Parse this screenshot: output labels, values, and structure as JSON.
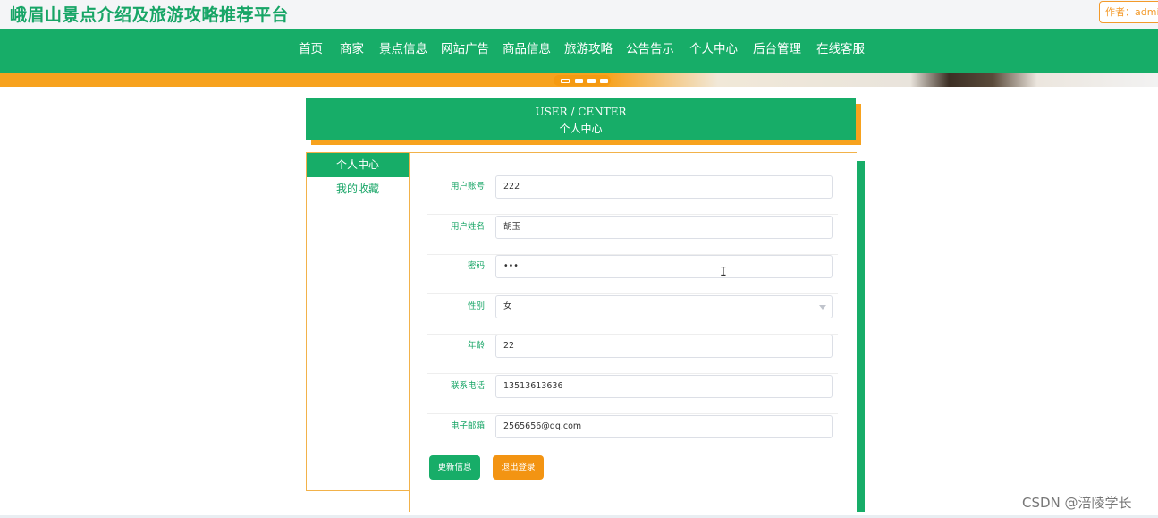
{
  "header": {
    "site_title": "峨眉山景点介绍及旅游攻略推荐平台",
    "author": "作者：admin"
  },
  "nav": {
    "items": [
      "首页",
      "商家",
      "景点信息",
      "网站广告",
      "商品信息",
      "旅游攻略",
      "公告告示",
      "个人中心",
      "后台管理",
      "在线客服"
    ]
  },
  "user_center": {
    "title_en": "USER / CENTER",
    "title_cn": "个人中心"
  },
  "sidebar": {
    "items": [
      {
        "label": "个人中心",
        "active": true
      },
      {
        "label": "我的收藏",
        "active": false
      }
    ]
  },
  "form": {
    "fields": [
      {
        "label": "用户账号",
        "value": "222"
      },
      {
        "label": "用户姓名",
        "value": "胡玉"
      },
      {
        "label": "密码",
        "value": "•••"
      },
      {
        "label": "性别",
        "value": "女"
      },
      {
        "label": "年龄",
        "value": "22"
      },
      {
        "label": "联系电话",
        "value": "13513613636"
      },
      {
        "label": "电子邮箱",
        "value": "2565656@qq.com"
      }
    ],
    "update_button": "更新信息",
    "logout_button": "退出登录"
  },
  "watermark": "CSDN @涪陵学长",
  "colors": {
    "primary_green": "#17ad68",
    "accent_orange": "#f7a21e"
  }
}
